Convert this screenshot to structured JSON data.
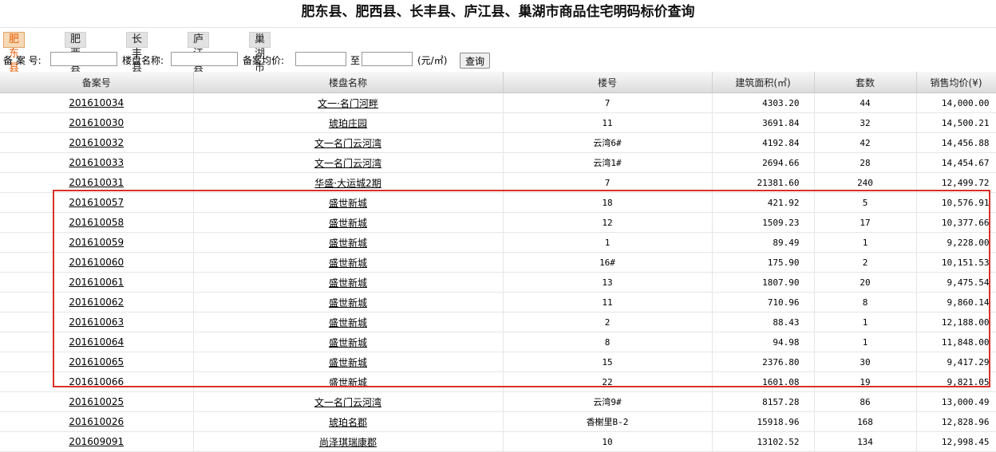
{
  "title": "肥东县、肥西县、长丰县、庐江县、巢湖市商品住宅明码标价查询",
  "tabs": [
    {
      "label": "肥东县",
      "active": true
    },
    {
      "label": "肥西县",
      "active": false
    },
    {
      "label": "长丰县",
      "active": false
    },
    {
      "label": "庐江县",
      "active": false
    },
    {
      "label": "巢湖市",
      "active": false
    }
  ],
  "search": {
    "record_no_label": "备 案 号:",
    "project_name_label": "楼盘名称:",
    "avg_price_label": "备案均价:",
    "to_label": "至",
    "unit_label": "(元/㎡)",
    "query_button": "查询",
    "record_no_value": "",
    "project_name_value": "",
    "price_min_value": "",
    "price_max_value": ""
  },
  "table": {
    "headers": [
      "备案号",
      "楼盘名称",
      "楼号",
      "建筑面积(㎡)",
      "套数",
      "销售均价(¥)"
    ],
    "rows": [
      {
        "id": "201610034",
        "name": "文一·名门河畔",
        "building": "7",
        "area": "4303.20",
        "units": "44",
        "price": "14,000.00"
      },
      {
        "id": "201610030",
        "name": "琥珀庄园",
        "building": "11",
        "area": "3691.84",
        "units": "32",
        "price": "14,500.21"
      },
      {
        "id": "201610032",
        "name": "文一名门云河湾",
        "building": "云湾6#",
        "area": "4192.84",
        "units": "42",
        "price": "14,456.88"
      },
      {
        "id": "201610033",
        "name": "文一名门云河湾",
        "building": "云湾1#",
        "area": "2694.66",
        "units": "28",
        "price": "14,454.67"
      },
      {
        "id": "201610031",
        "name": "华盛·大运城2期",
        "building": "7",
        "area": "21381.60",
        "units": "240",
        "price": "12,499.72"
      },
      {
        "id": "201610057",
        "name": "盛世新城",
        "building": "18",
        "area": "421.92",
        "units": "5",
        "price": "10,576.91"
      },
      {
        "id": "201610058",
        "name": "盛世新城",
        "building": "12",
        "area": "1509.23",
        "units": "17",
        "price": "10,377.66"
      },
      {
        "id": "201610059",
        "name": "盛世新城",
        "building": "1",
        "area": "89.49",
        "units": "1",
        "price": "9,228.00"
      },
      {
        "id": "201610060",
        "name": "盛世新城",
        "building": "16#",
        "area": "175.90",
        "units": "2",
        "price": "10,151.53"
      },
      {
        "id": "201610061",
        "name": "盛世新城",
        "building": "13",
        "area": "1807.90",
        "units": "20",
        "price": "9,475.54"
      },
      {
        "id": "201610062",
        "name": "盛世新城",
        "building": "11",
        "area": "710.96",
        "units": "8",
        "price": "9,860.14"
      },
      {
        "id": "201610063",
        "name": "盛世新城",
        "building": "2",
        "area": "88.43",
        "units": "1",
        "price": "12,188.00"
      },
      {
        "id": "201610064",
        "name": "盛世新城",
        "building": "8",
        "area": "94.98",
        "units": "1",
        "price": "11,848.00"
      },
      {
        "id": "201610065",
        "name": "盛世新城",
        "building": "15",
        "area": "2376.80",
        "units": "30",
        "price": "9,417.29"
      },
      {
        "id": "201610066",
        "name": "盛世新城",
        "building": "22",
        "area": "1601.08",
        "units": "19",
        "price": "9,821.05"
      },
      {
        "id": "201610025",
        "name": "文一名门云河湾",
        "building": "云湾9#",
        "area": "8157.28",
        "units": "86",
        "price": "13,000.49"
      },
      {
        "id": "201610026",
        "name": "琥珀名郡",
        "building": "香榭里B-2",
        "area": "15918.96",
        "units": "168",
        "price": "12,828.96"
      },
      {
        "id": "201609091",
        "name": "尚泽琪瑞康郡",
        "building": "10",
        "area": "13102.52",
        "units": "134",
        "price": "12,998.45"
      }
    ]
  },
  "highlight_color": "#d9302a"
}
